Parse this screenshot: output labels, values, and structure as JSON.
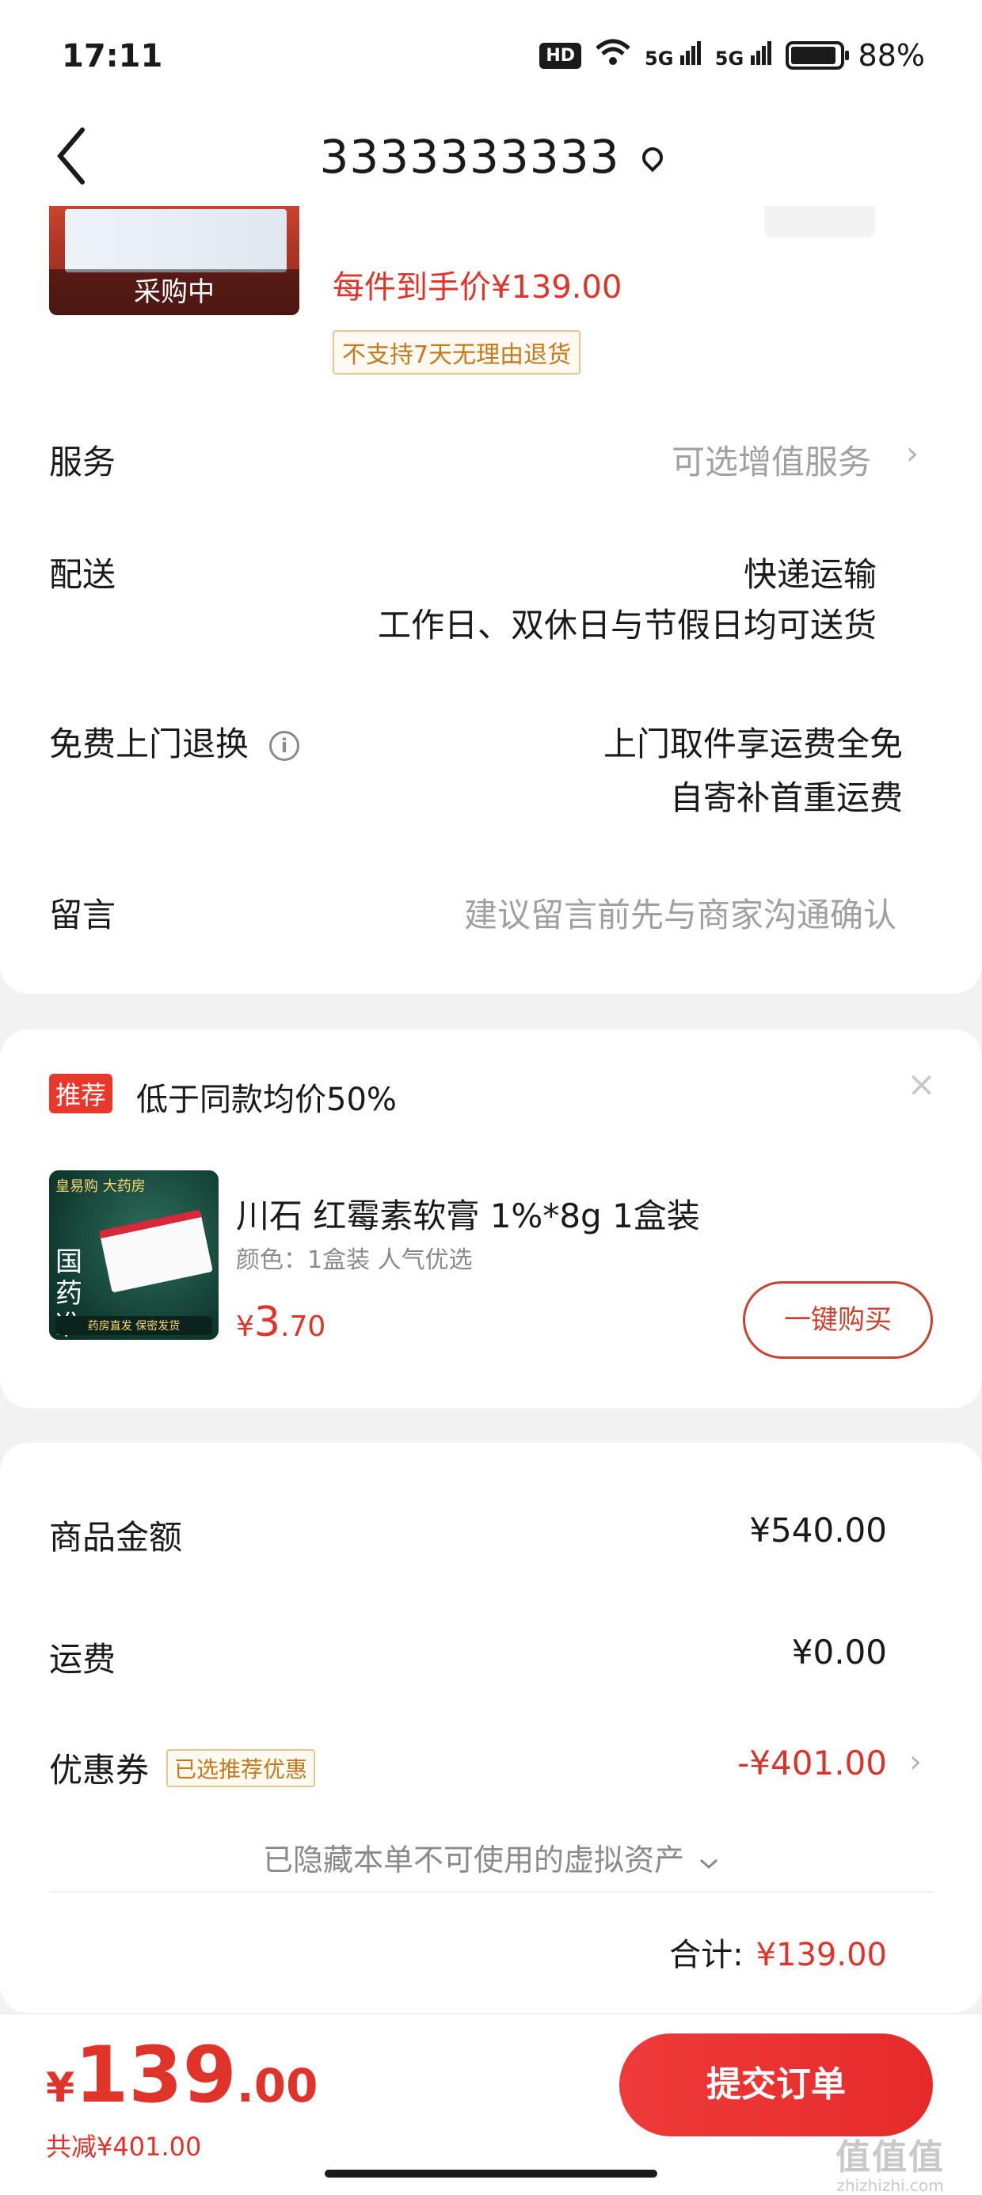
{
  "status_bar": {
    "time": "17:11",
    "hd": "HD",
    "signal_1": "5G",
    "signal_2": "5G",
    "battery": "88%"
  },
  "nav": {
    "title": "3333333333",
    "back_icon": "chevron-left-icon",
    "location_icon": "location-pin-icon"
  },
  "product": {
    "thumbnail_tag": "采购中",
    "unit_price": "每件到手价¥139.00",
    "return_policy": "不支持7天无理由退货"
  },
  "rows": {
    "service_label": "服务",
    "service_value": "可选增值服务",
    "delivery_label": "配送",
    "delivery_value_1": "快递运输",
    "delivery_value_2": "工作日、双休日与节假日均可送货",
    "return_label": "免费上门退换",
    "return_value_1": "上门取件享运费全免",
    "return_value_2": "自寄补首重运费",
    "message_label": "留言",
    "message_placeholder": "建议留言前先与商家沟通确认"
  },
  "recommend": {
    "badge": "推荐",
    "text": "低于同款均价50%",
    "close": "×",
    "product_name": "川石 红霉素软膏 1%*8g 1盒装",
    "product_spec": "颜色：1盒装 人气优选",
    "price_symbol": "¥",
    "price_int": "3",
    "price_dec": ".70",
    "buy_button": "一键购买",
    "thumb_top": "皇易购 大药房",
    "thumb_text": "国药准字",
    "thumb_bottom": "药房直发 保密发货"
  },
  "summary": {
    "goods_label": "商品金额",
    "goods_value": "¥540.00",
    "shipping_label": "运费",
    "shipping_value": "¥0.00",
    "coupon_label": "优惠券",
    "coupon_tag": "已选推荐优惠",
    "coupon_value": "-¥401.00",
    "hidden_assets": "已隐藏本单不可使用的虚拟资产",
    "total_label": "合计:",
    "total_value": "¥139.00"
  },
  "bottom": {
    "symbol": "¥",
    "int": "139",
    "dec": ".00",
    "reduce": "共减¥401.00",
    "submit": "提交订单"
  },
  "watermark": {
    "text": "值值值",
    "sub": "zhizhizhi.com"
  },
  "colors": {
    "accent_red": "#e0332a",
    "tag_gold": "#c47a1c",
    "background": "#f2f2f2"
  }
}
